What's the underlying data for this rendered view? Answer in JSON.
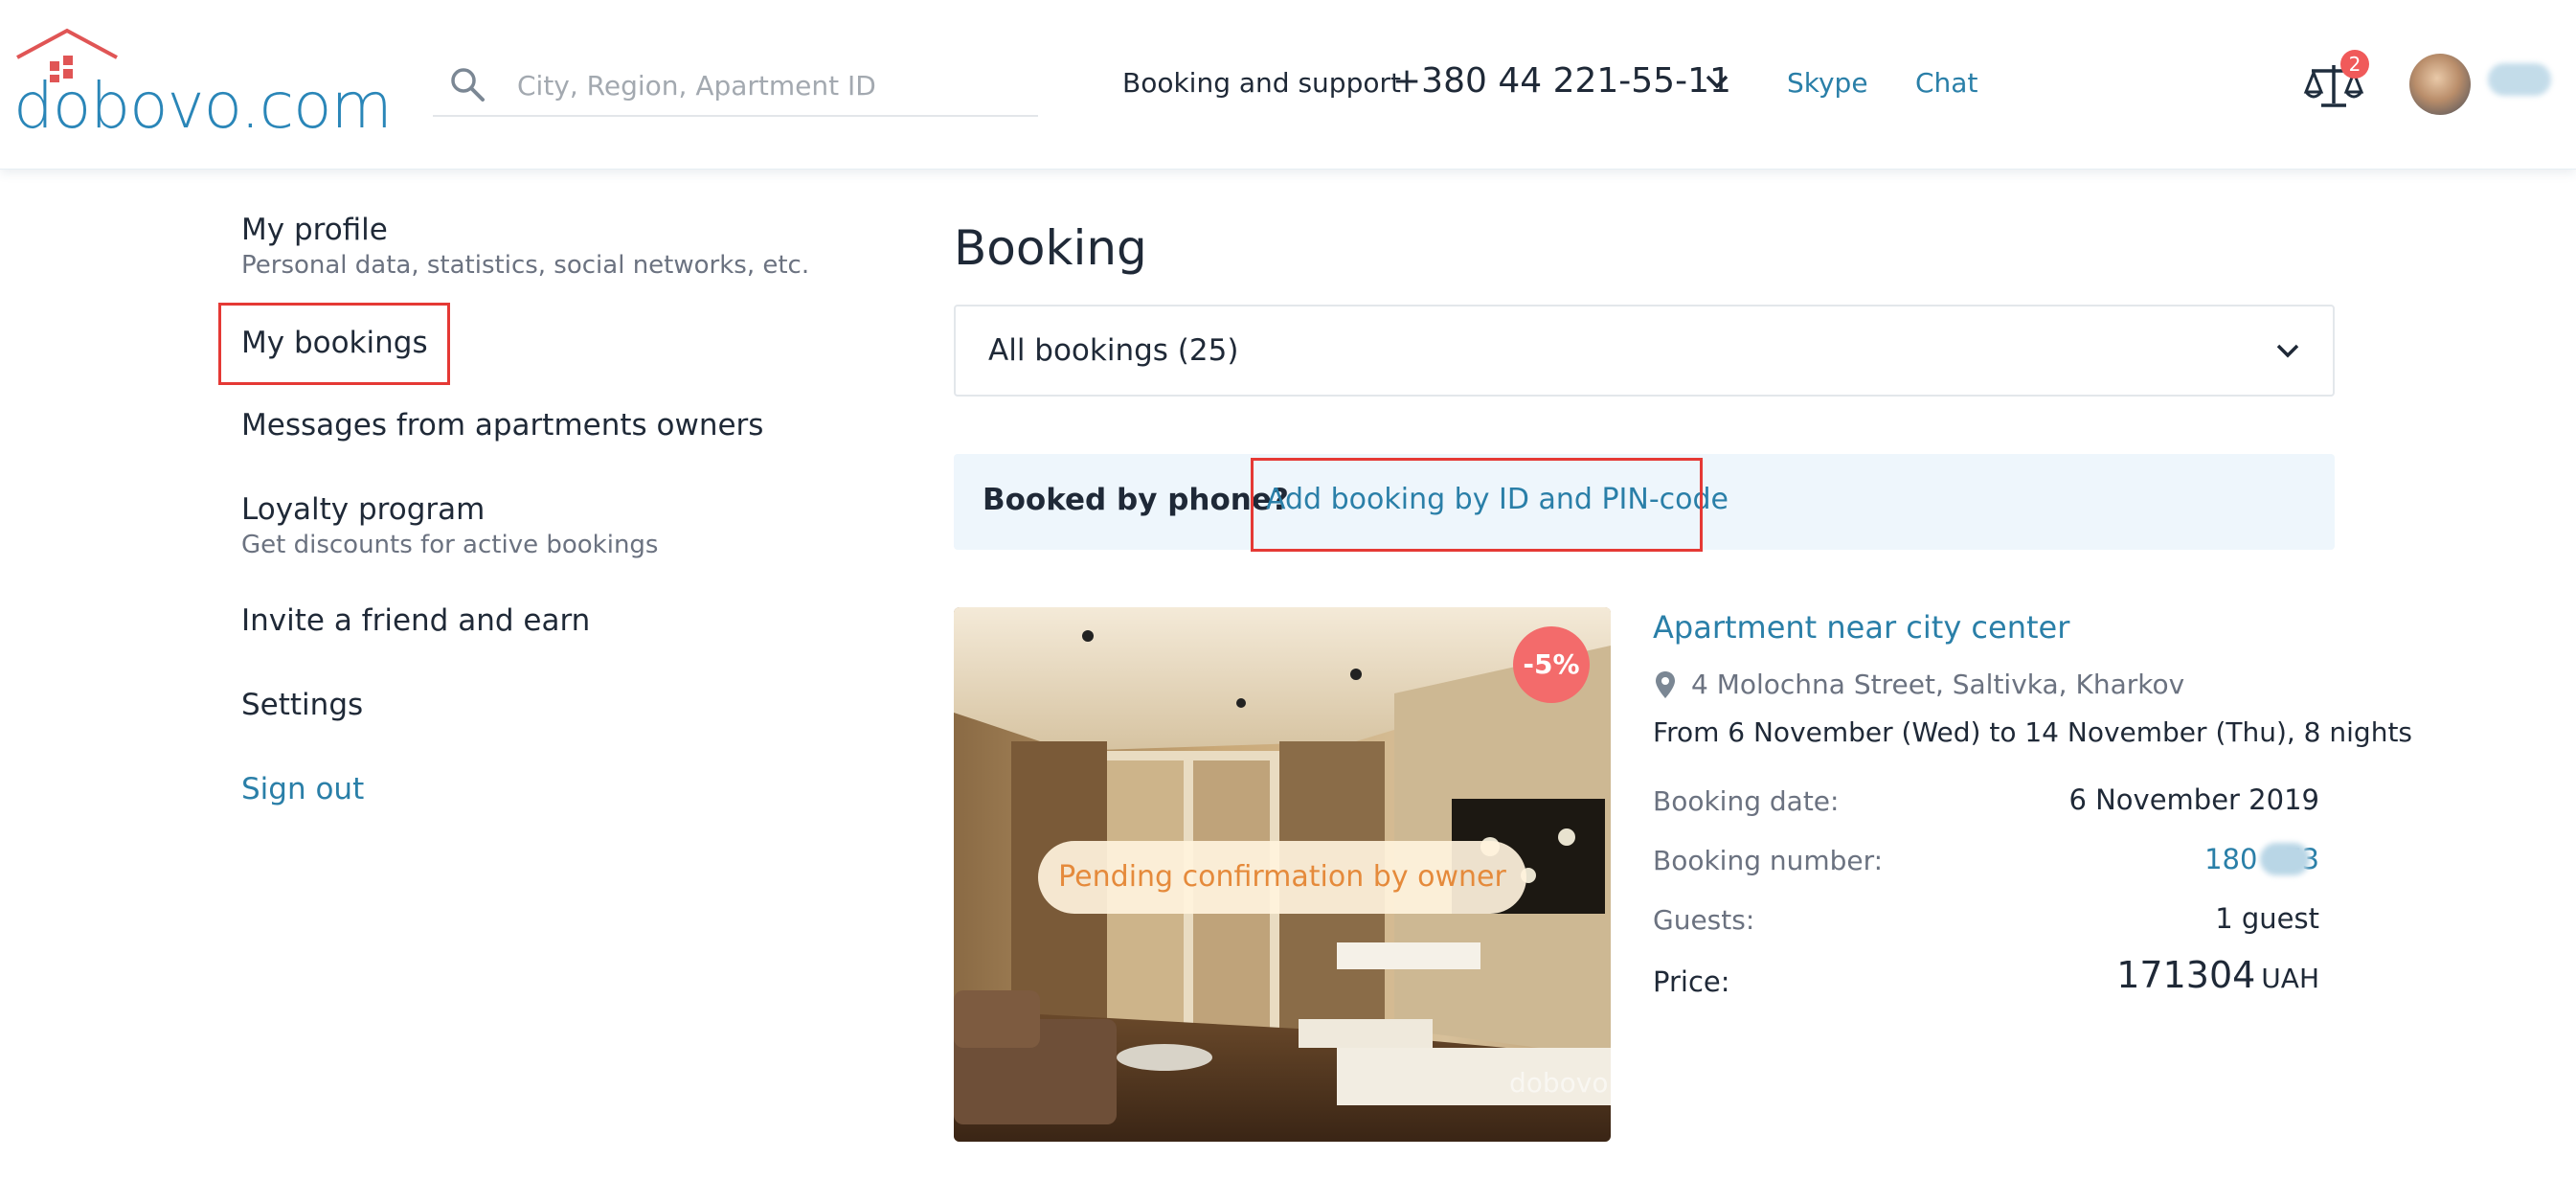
{
  "header": {
    "logo_text": "dobovo.com",
    "search_placeholder": "City, Region, Apartment ID",
    "support_label": "Booking and support",
    "phone": "+380 44 221-55-11",
    "links": {
      "skype": "Skype",
      "chat": "Chat"
    },
    "compare_count": "2"
  },
  "sidebar": {
    "items": [
      {
        "label": "My profile",
        "sub": "Personal data, statistics, social networks, etc."
      },
      {
        "label": "My bookings"
      },
      {
        "label": "Messages from apartments owners"
      },
      {
        "label": "Loyalty program",
        "sub": "Get discounts for active bookings"
      },
      {
        "label": "Invite a friend and earn"
      },
      {
        "label": "Settings"
      },
      {
        "label": "Sign out"
      }
    ]
  },
  "main": {
    "title": "Booking",
    "filter_value": "All bookings (25)",
    "banner": {
      "question": "Booked by phone?",
      "link": "Add booking by ID and PIN-code"
    },
    "booking": {
      "discount": "-5%",
      "status": "Pending confirmation by owner",
      "watermark": "dobovo.",
      "title": "Apartment near city center",
      "address": "4 Molochna Street, Saltivka, Kharkov",
      "dates": "From 6 November (Wed) to 14 November (Thu), 8 nights",
      "rows": [
        {
          "label": "Booking date:",
          "value": "6 November 2019"
        },
        {
          "label": "Booking number:",
          "value": "180   73"
        },
        {
          "label": "Guests:",
          "value": "1 guest"
        }
      ],
      "price_label": "Price:",
      "price_value": "171304",
      "price_currency": "UAH"
    }
  },
  "colors": {
    "accent": "#2a7fa8",
    "highlight": "#e53935",
    "badge": "#f36b6b",
    "status_text": "#e58a3b"
  }
}
